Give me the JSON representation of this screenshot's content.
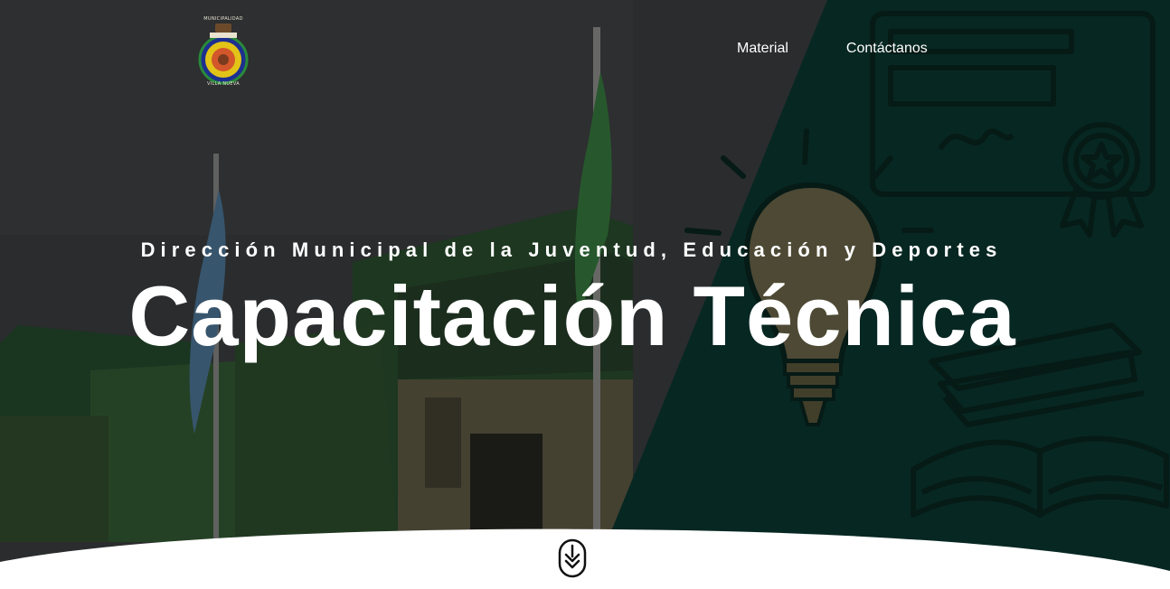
{
  "logo": {
    "text_top": "MUNICIPALIDAD",
    "text_bottom": "VILLA NUEVA"
  },
  "nav": {
    "items": [
      {
        "label": "Material"
      },
      {
        "label": "Contáctanos"
      }
    ]
  },
  "hero": {
    "subtitle": "Dirección Municipal de la Juventud, Educación y Deportes",
    "title": "Capacitación Técnica"
  },
  "icons": {
    "scroll": "scroll-down-icon",
    "lightbulb": "lightbulb-icon",
    "certificate": "certificate-icon",
    "books": "books-icon"
  },
  "colors": {
    "chalkboard": "#0c4038",
    "sky": "#3f4244",
    "text": "#ffffff",
    "bottom": "#ffffff"
  }
}
